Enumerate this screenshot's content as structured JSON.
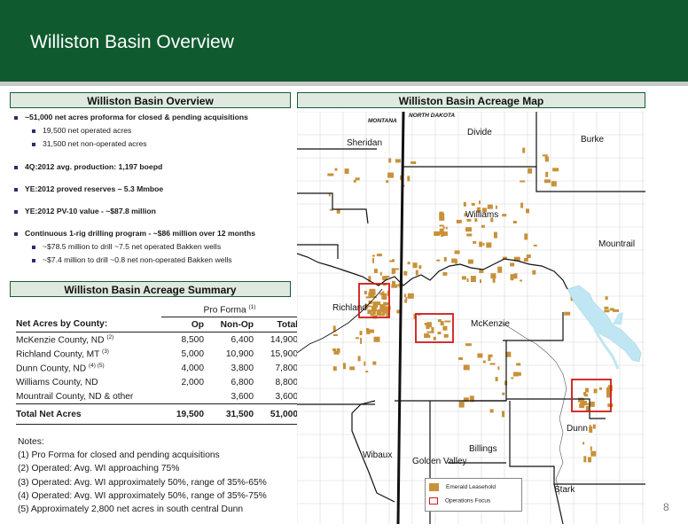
{
  "header": {
    "title": "Williston Basin Overview"
  },
  "overview": {
    "heading": "Williston Basin Overview",
    "bullets": [
      "~51,000 net acres proforma for closed & pending acquisitions",
      "19,500 net operated acres",
      "31,500 net non-operated acres",
      "4Q:2012 avg. production: 1,197 boepd",
      "YE:2012 proved reserves – 5.3 Mmboe",
      "YE:2012 PV-10 value - ~$87.8 million",
      "Continuous 1-rig drilling program - ~$86 million over 12 months",
      "~$78.5 million to drill ~7.5 net operated Bakken wells",
      "~$7.4 million to drill ~0.8 net non-operated Bakken wells"
    ]
  },
  "summary": {
    "heading": "Williston Basin Acreage Summary",
    "pro_forma": "Pro Forma",
    "pro_forma_sup": "(1)",
    "col_label": "Net Acres by County:",
    "col_op": "Op",
    "col_nonop": "Non-Op",
    "col_total": "Total",
    "rows": [
      {
        "county": "McKenzie County, ND",
        "sup": "(2)",
        "op": "8,500",
        "nonop": "6,400",
        "total": "14,900"
      },
      {
        "county": "Richland County, MT",
        "sup": "(3)",
        "op": "5,000",
        "nonop": "10,900",
        "total": "15,900"
      },
      {
        "county": "Dunn County, ND",
        "sup": "(4) (5)",
        "op": "4,000",
        "nonop": "3,800",
        "total": "7,800"
      },
      {
        "county": "Williams County, ND",
        "sup": "",
        "op": "2,000",
        "nonop": "6,800",
        "total": "8,800"
      },
      {
        "county": "Mountrail County, ND & other",
        "sup": "",
        "op": "",
        "nonop": "3,600",
        "total": "3,600"
      }
    ],
    "total": {
      "county": "Total Net Acres",
      "op": "19,500",
      "nonop": "31,500",
      "total": "51,000"
    }
  },
  "notes": {
    "title": "Notes:",
    "lines": [
      "(1) Pro Forma for closed and pending acquisitions",
      "(2) Operated: Avg. WI approaching 75%",
      "(3) Operated: Avg. WI approximately 50%, range of 35%-65%",
      "(4) Operated: Avg. WI approximately 50%, range of 35%-75%",
      "(5) Approximately 2,800 net acres in south central Dunn"
    ]
  },
  "map": {
    "heading": "Williston Basin Acreage Map",
    "states": {
      "west": "MONTANA",
      "east": "NORTH DAKOTA"
    },
    "counties": {
      "sheridan": "Sheridan",
      "divide": "Divide",
      "burke": "Burke",
      "williams": "Williams",
      "mountrail": "Mountrail",
      "richland": "Richland",
      "mckenzie": "McKenzie",
      "dunn": "Dunn",
      "billings": "Billings",
      "wibaux": "Wibaux",
      "golden_valley": "Golden Valley",
      "stark": "Stark"
    },
    "legend": {
      "leasehold": "Emerald Leasehold",
      "focus": "Operations Focus"
    }
  },
  "colors": {
    "header": "#0f5a2e",
    "leasehold": "#c8913a",
    "focus": "#d01818",
    "water": "#bfe6f2"
  },
  "page_number": "8"
}
